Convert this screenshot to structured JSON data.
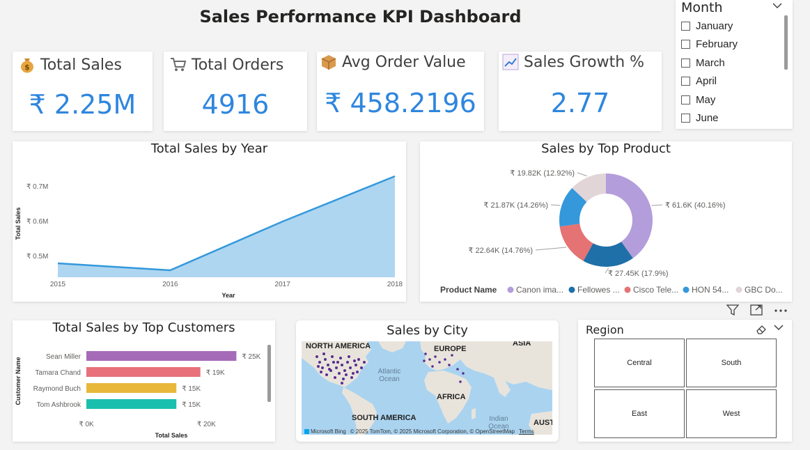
{
  "page": {
    "title": "Sales Performance KPI Dashboard"
  },
  "kpis": [
    {
      "title": "Total Sales",
      "value": "₹ 2.25M",
      "icon": "money-bag-icon"
    },
    {
      "title": "Total Orders",
      "value": "4916",
      "icon": "shopping-cart-icon"
    },
    {
      "title": "Avg Order Value",
      "value": "₹ 458.2196",
      "icon": "package-icon"
    },
    {
      "title": "Sales Growth %",
      "value": "2.77",
      "icon": "trend-chart-icon"
    }
  ],
  "month_slicer": {
    "title": "Month",
    "items": [
      "January",
      "February",
      "March",
      "April",
      "May",
      "June"
    ]
  },
  "region_slicer": {
    "title": "Region",
    "items": [
      "Central",
      "South",
      "East",
      "West"
    ]
  },
  "colors": {
    "accent": "#2e86de",
    "area_fill": "#aed6f1",
    "area_line": "#3498db",
    "product": [
      "#b39ddb",
      "#1f6fa8",
      "#e57373",
      "#3498db",
      "#e1d5d8"
    ],
    "customers": [
      "#a66bb8",
      "#e8707a",
      "#e8b83b",
      "#1bbfad"
    ]
  },
  "chart_data": [
    {
      "id": "sales_by_year",
      "type": "area",
      "title": "Total Sales by Year",
      "xlabel": "Year",
      "ylabel": "Total Sales",
      "x": [
        "2015",
        "2016",
        "2017",
        "2018"
      ],
      "values": [
        0.48,
        0.46,
        0.6,
        0.73
      ],
      "yticks": [
        "₹ 0.5M",
        "₹ 0.6M",
        "₹ 0.7M"
      ],
      "ytick_values": [
        0.5,
        0.6,
        0.7
      ],
      "ylim": [
        0.44,
        0.75
      ]
    },
    {
      "id": "sales_by_top_product",
      "type": "pie",
      "title": "Sales by Top Product",
      "legend_title": "Product Name",
      "categories": [
        "Canon ima...",
        "Fellowes ...",
        "Cisco Tele...",
        "HON 54...",
        "GBC Do..."
      ],
      "values": [
        61.6,
        27.45,
        22.64,
        21.87,
        19.82
      ],
      "labels": [
        "₹ 61.6K (40.16%)",
        "₹ 27.45K (17.9%)",
        "₹ 22.64K (14.76%)",
        "₹ 21.87K (14.26%)",
        "₹ 19.82K (12.92%)"
      ]
    },
    {
      "id": "sales_by_top_customers",
      "type": "bar",
      "title": "Total Sales by Top Customers",
      "xlabel": "Total Sales",
      "ylabel": "Customer Name",
      "categories": [
        "Sean Miller",
        "Tamara Chand",
        "Raymond Buch",
        "Tom Ashbrook"
      ],
      "values": [
        25,
        19,
        15,
        15
      ],
      "labels": [
        "₹ 25K",
        "₹ 19K",
        "₹ 15K",
        "₹ 15K"
      ],
      "xticks": [
        "₹ 0K",
        "₹ 20K"
      ],
      "xtick_values": [
        0,
        20
      ],
      "xlim": [
        0,
        26
      ]
    }
  ],
  "map": {
    "title": "Sales by City",
    "labels": {
      "north_america": "NORTH AMERICA",
      "europe": "EUROPE",
      "asia": "ASIA",
      "africa": "AFRICA",
      "south_america": "SOUTH AMERICA",
      "australia": "AUST"
    },
    "oceans": {
      "atlantic": "Atlantic Ocean",
      "indian": "Indian Ocean"
    },
    "attribution": "Microsoft Bing",
    "copyright": "© 2025 TomTom, © 2025 Microsoft Corporation, © OpenStreetMap",
    "terms": "Terms"
  }
}
